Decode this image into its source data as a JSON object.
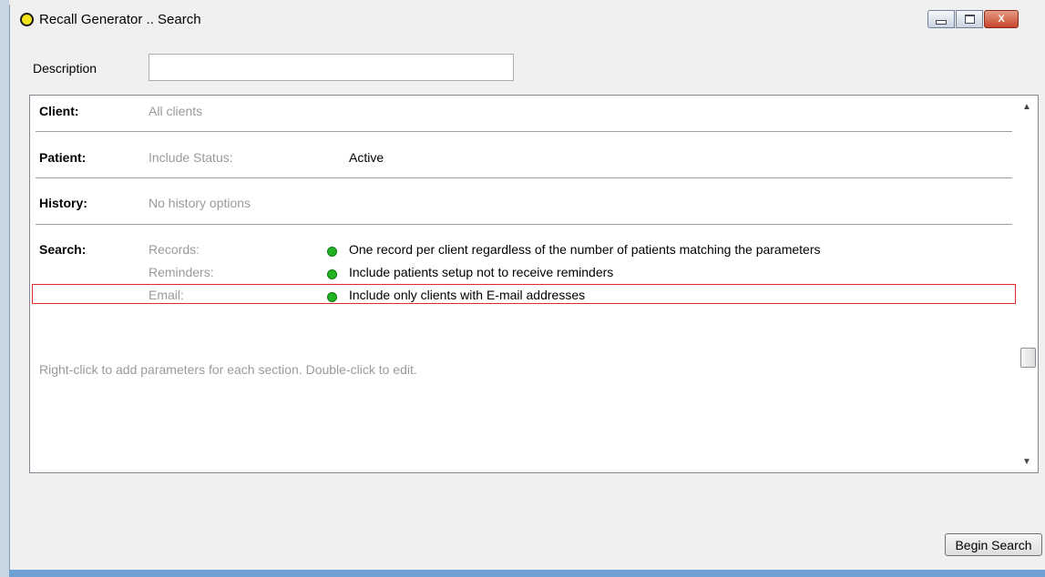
{
  "window": {
    "title": "Recall Generator .. Search",
    "app_icon": "yellow-circle-icon",
    "controls": [
      "minimize-icon",
      "maximize-icon",
      "close-icon"
    ],
    "close_glyph": "X"
  },
  "description": {
    "label": "Description",
    "value": "",
    "placeholder": ""
  },
  "sections": {
    "client": {
      "label": "Client:",
      "param": "All clients"
    },
    "patient": {
      "label": "Patient:",
      "param": "Include Status:",
      "value": "Active"
    },
    "history": {
      "label": "History:",
      "param": "No history options"
    },
    "search": {
      "label": "Search:",
      "rows": [
        {
          "param": "Records:",
          "value": "One record per client regardless of the number of patients matching the parameters"
        },
        {
          "param": "Reminders:",
          "value": "Include patients setup not to receive reminders"
        },
        {
          "param": "Email:",
          "value": "Include only clients with E-mail addresses"
        }
      ]
    }
  },
  "hint": "Right-click to add parameters for each section. Double-click to edit.",
  "buttons": {
    "begin_search": "Begin Search"
  },
  "colors": {
    "bullet": "#22b322",
    "highlight_border": "#e02a2a",
    "muted_text": "#9a9a9a"
  }
}
